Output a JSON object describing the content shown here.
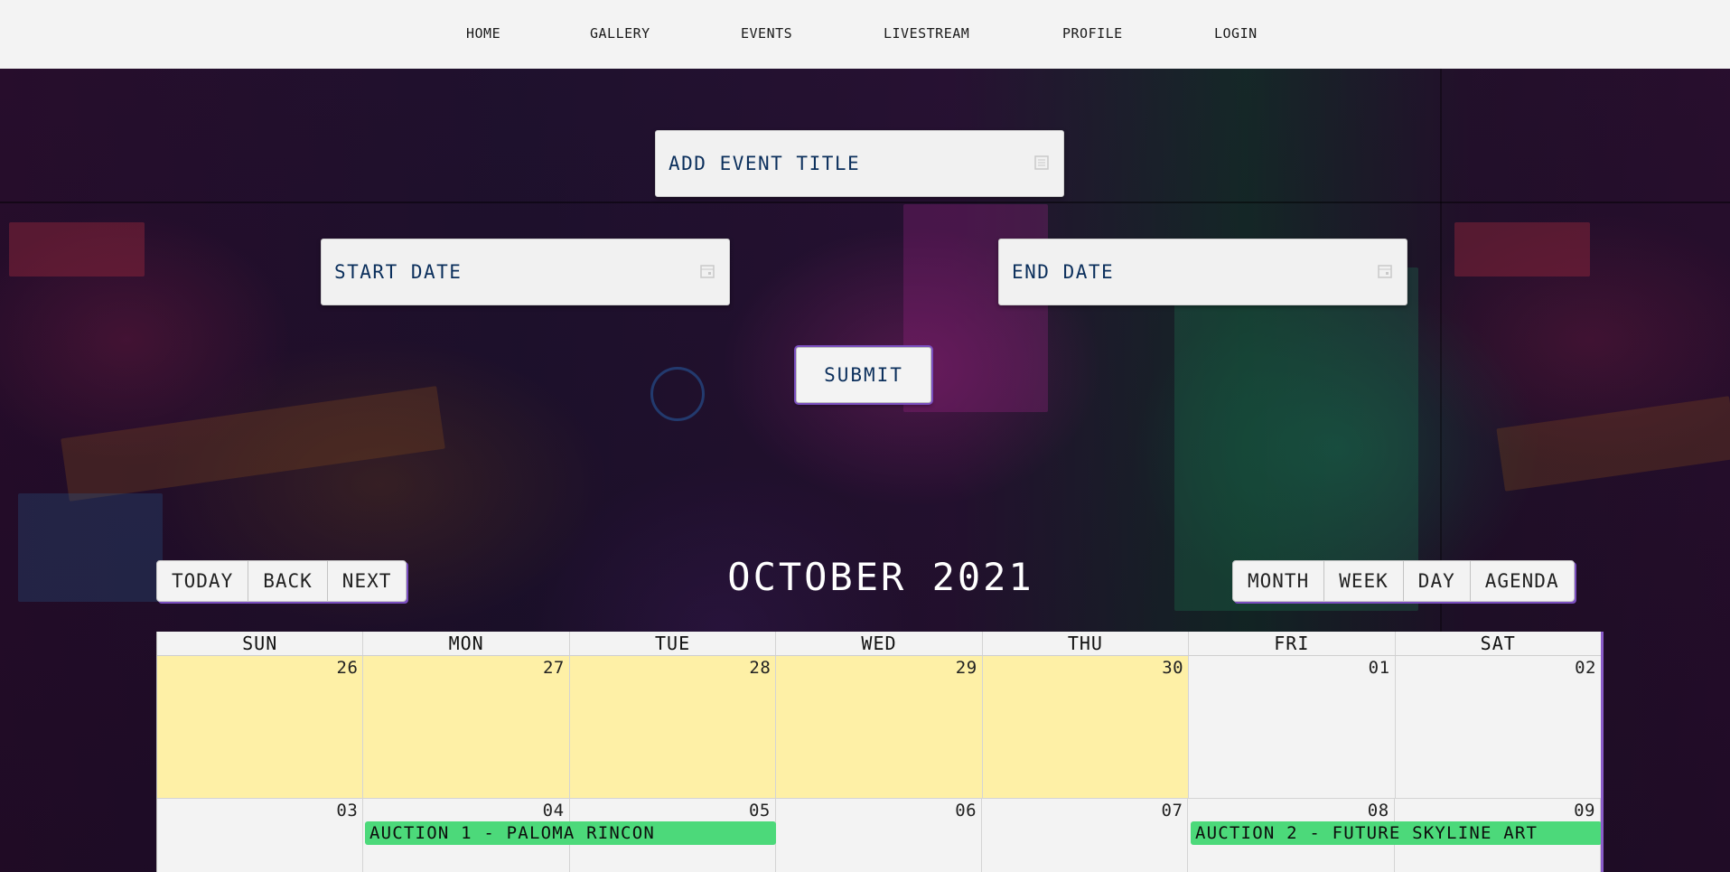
{
  "nav": {
    "items": [
      {
        "label": "HOME"
      },
      {
        "label": "GALLERY"
      },
      {
        "label": "EVENTS"
      },
      {
        "label": "LIVESTREAM"
      },
      {
        "label": "PROFILE"
      },
      {
        "label": "LOGIN"
      }
    ]
  },
  "form": {
    "title_placeholder": "ADD EVENT TITLE",
    "start_placeholder": "START DATE",
    "end_placeholder": "END DATE",
    "submit_label": "SUBMIT"
  },
  "calendar": {
    "title": "OCTOBER 2021",
    "nav_buttons": [
      "TODAY",
      "BACK",
      "NEXT"
    ],
    "view_buttons": [
      "MONTH",
      "WEEK",
      "DAY",
      "AGENDA"
    ],
    "weekdays": [
      "SUN",
      "MON",
      "TUE",
      "WED",
      "THU",
      "FRI",
      "SAT"
    ],
    "weeks": [
      [
        "26",
        "27",
        "28",
        "29",
        "30",
        "01",
        "02"
      ],
      [
        "03",
        "04",
        "05",
        "06",
        "07",
        "08",
        "09"
      ]
    ],
    "events": [
      {
        "title": "AUCTION 1 - PALOMA RINCON"
      },
      {
        "title": "AUCTION 2 - FUTURE SKYLINE ART"
      }
    ],
    "colors": {
      "off_month_bg": "#fef0a6",
      "event_bg": "#4cd97a",
      "accent": "#7a4fbf"
    }
  }
}
